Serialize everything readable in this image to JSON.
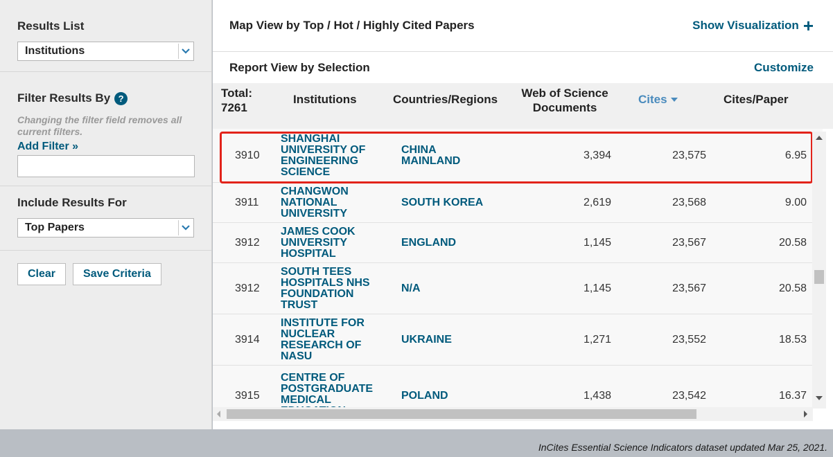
{
  "sidebar": {
    "results_list": {
      "label": "Results List",
      "selected": "Institutions"
    },
    "filter": {
      "label": "Filter Results By",
      "help": "?",
      "note": "Changing the filter field removes all current filters.",
      "add_filter": "Add Filter »",
      "input_value": ""
    },
    "include": {
      "label": "Include Results For",
      "selected": "Top Papers"
    },
    "buttons": {
      "clear": "Clear",
      "save": "Save Criteria"
    }
  },
  "main": {
    "map_title": "Map View by Top / Hot / Highly Cited Papers",
    "show_viz": "Show Visualization",
    "report_title": "Report View by Selection",
    "customize": "Customize"
  },
  "table": {
    "headers": {
      "total": "Total:\n7261",
      "institutions": "Institutions",
      "countries": "Countries/Regions",
      "wos": "Web of Science Documents",
      "cites": "Cites",
      "cites_per_paper": "Cites/Paper"
    },
    "rows": [
      {
        "rank": "3910",
        "institution": "SHANGHAI UNIVERSITY OF ENGINEERING SCIENCE",
        "country": "CHINA MAINLAND",
        "docs": "3,394",
        "cites": "23,575",
        "cpp": "6.95"
      },
      {
        "rank": "3911",
        "institution": "CHANGWON NATIONAL UNIVERSITY",
        "country": "SOUTH KOREA",
        "docs": "2,619",
        "cites": "23,568",
        "cpp": "9.00"
      },
      {
        "rank": "3912",
        "institution": "JAMES COOK UNIVERSITY HOSPITAL",
        "country": "ENGLAND",
        "docs": "1,145",
        "cites": "23,567",
        "cpp": "20.58"
      },
      {
        "rank": "3912",
        "institution": "SOUTH TEES HOSPITALS NHS FOUNDATION TRUST",
        "country": "N/A",
        "docs": "1,145",
        "cites": "23,567",
        "cpp": "20.58"
      },
      {
        "rank": "3914",
        "institution": "INSTITUTE FOR NUCLEAR RESEARCH OF NASU",
        "country": "UKRAINE",
        "docs": "1,271",
        "cites": "23,552",
        "cpp": "18.53"
      },
      {
        "rank": "3915",
        "institution": "CENTRE OF POSTGRADUATE MEDICAL EDUCATION",
        "country": "POLAND",
        "docs": "1,438",
        "cites": "23,542",
        "cpp": "16.37"
      }
    ]
  },
  "footer": "InCites Essential Science Indicators dataset updated Mar 25, 2021."
}
